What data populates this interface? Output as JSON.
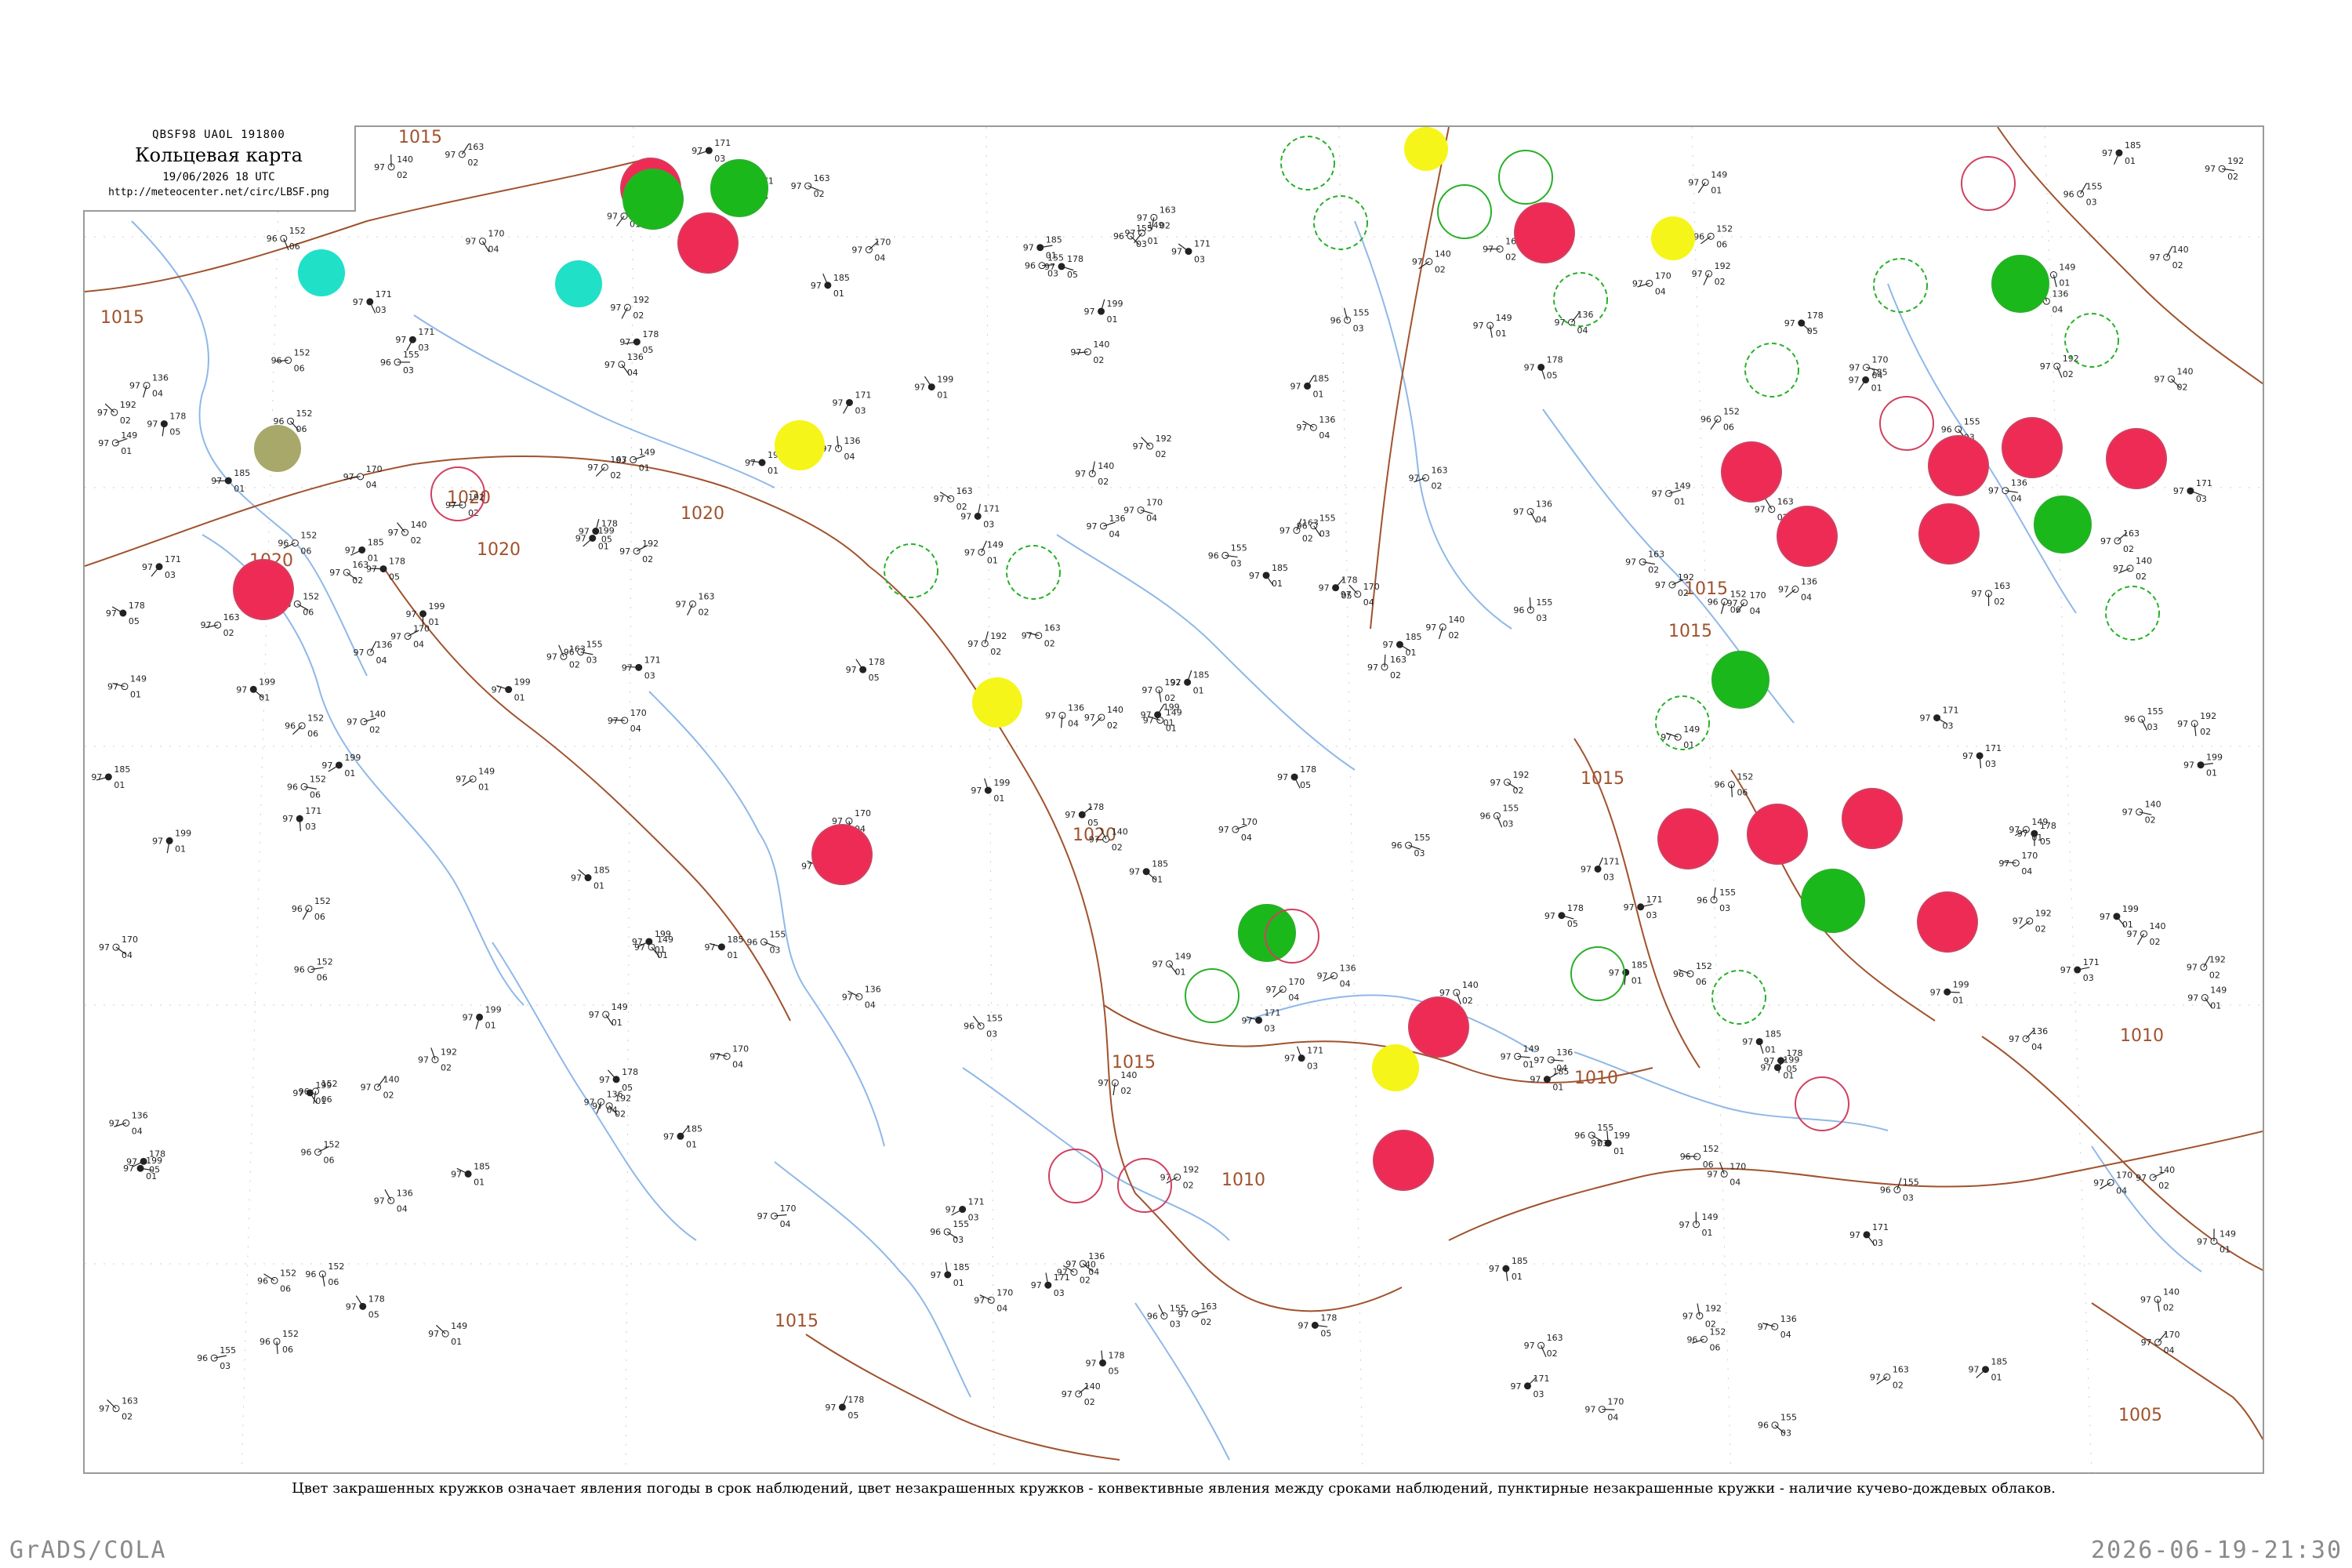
{
  "header": {
    "codes": "QBSF98  UAOL  191800",
    "title": "Кольцевая карта",
    "datetime": "19/06/2026 18 UTC",
    "url": "http://meteocenter.net/circ/LBSF.png"
  },
  "legend": "Цвет закрашенных кружков означает явления погоды в срок наблюдений, цвет незакрашенных кружков - конвективные явления между сроками наблюдений, пунктирные незакрашенные кружки - наличие кучево-дождевых облаков.",
  "footer": {
    "left": "GrADS/COLA",
    "right": "2026-06-19-21:30"
  },
  "colors": {
    "isobar": "#a0522d",
    "water": "#8fb8e8",
    "frame": "#9a9a9a",
    "thunder_fill": "#ee2b55",
    "rain_fill": "#1bb81b",
    "shower_fill": "#f5f51a",
    "fog_fill": "#20e0c8",
    "haze_fill": "#a8a86a",
    "convective_ring": "#d04060",
    "cb_ring": "#28b028"
  },
  "isobars": [
    {
      "label": "1015"
    },
    {
      "label": "1015"
    },
    {
      "label": "1020"
    },
    {
      "label": "1020"
    },
    {
      "label": "1020"
    },
    {
      "label": "1020"
    },
    {
      "label": "1015"
    },
    {
      "label": "1015"
    },
    {
      "label": "1015"
    },
    {
      "label": "1010"
    },
    {
      "label": "1015"
    },
    {
      "label": "1010"
    },
    {
      "label": "1010"
    },
    {
      "label": "1005"
    },
    {
      "label": "1020"
    },
    {
      "label": "1015"
    }
  ],
  "stations": [
    {
      "p": "185",
      "t": "97",
      "d": "01",
      "w": "#222"
    },
    {
      "p": "170",
      "t": "97",
      "d": "04",
      "w": "#222"
    },
    {
      "p": "152",
      "t": "96",
      "d": "06",
      "w": "#222"
    },
    {
      "p": "171",
      "t": "97",
      "d": "03",
      "w": "#222"
    },
    {
      "p": "163",
      "t": "97",
      "d": "02",
      "w": "#222"
    },
    {
      "p": "149",
      "t": "97",
      "d": "01",
      "w": "#222"
    },
    {
      "p": "178",
      "t": "97",
      "d": "05",
      "w": "#222"
    },
    {
      "p": "155",
      "t": "96",
      "d": "03",
      "w": "#222"
    },
    {
      "p": "140",
      "t": "97",
      "d": "02",
      "w": "#222"
    },
    {
      "p": "199",
      "t": "97",
      "d": "01",
      "w": "#222"
    },
    {
      "p": "136",
      "t": "97",
      "d": "04",
      "w": "#222"
    },
    {
      "p": "192",
      "t": "97",
      "d": "02",
      "w": "#222"
    }
  ]
}
